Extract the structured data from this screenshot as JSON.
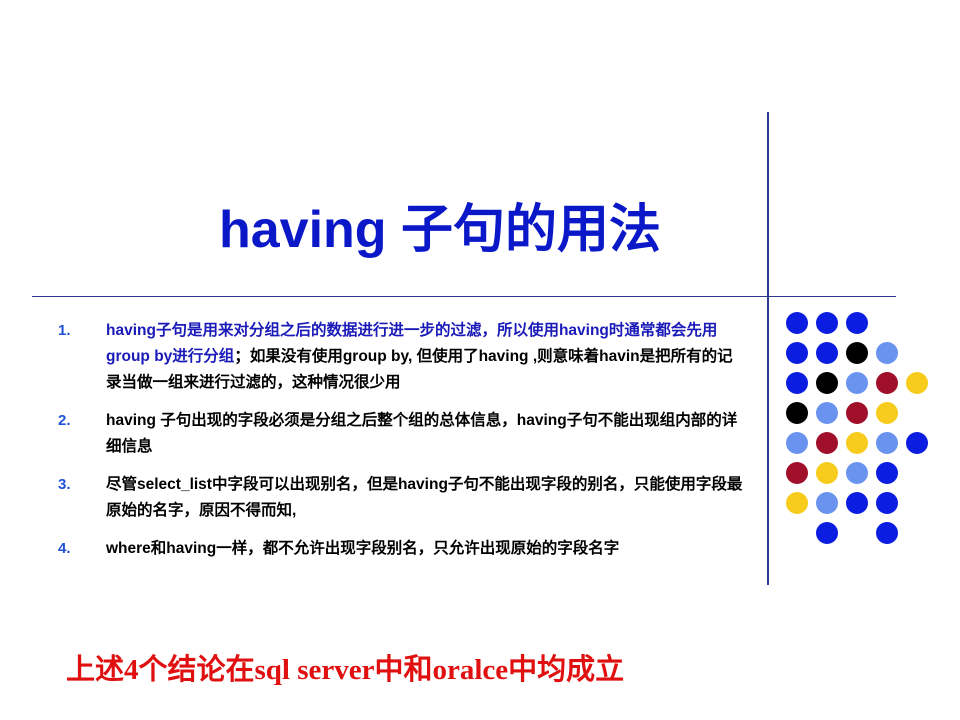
{
  "slide": {
    "title": "having 子句的用法",
    "items": [
      {
        "number": "1.",
        "parts": [
          {
            "text": "having子句是用来对分组之后的数据进行进一步的过滤，所以使用having时通常都会先用group by进行分组",
            "color": "blue"
          },
          {
            "text": "；如果没有使用group by, 但使用了having ,则意味着havin是把所有的记录当做一组来进行过滤的，这种情况很少用",
            "color": "black"
          }
        ]
      },
      {
        "number": "2.",
        "parts": [
          {
            "text": "having 子句出现的字段必须是分组之后整个组的总体信息，having子句不能出现组内部的详细信息",
            "color": "black"
          }
        ]
      },
      {
        "number": "3.",
        "parts": [
          {
            "text": "尽管select_list中字段可以出现别名，但是having子句不能出现字段的别名，只能使用字段最原始的名字，原因不得而知,",
            "color": "black"
          }
        ]
      },
      {
        "number": "4.",
        "parts": [
          {
            "text": "where和having一样，都不允许出现字段别名，只允许出现原始的字段名字",
            "color": "black"
          }
        ]
      }
    ],
    "conclusion": "上述4个结论在sql server中和oralce中均成立"
  },
  "colors": {
    "title": "#0a18c8",
    "number": "#1f52d6",
    "blue_text": "#1a1ab8",
    "conclusion": "#e01010",
    "rule": "#2b3a8f",
    "dot_blue": "#0a1de0",
    "dot_black": "#000000",
    "dot_lightblue": "#6a93f0",
    "dot_red": "#a0102a",
    "dot_yellow": "#f8cc1c"
  },
  "dot_grid": [
    [
      "blue",
      "blue",
      "blue",
      null,
      null
    ],
    [
      "blue",
      "blue",
      "black",
      "lightblue",
      null
    ],
    [
      "blue",
      "black",
      "lightblue",
      "red",
      "yellow"
    ],
    [
      "black",
      "lightblue",
      "red",
      "yellow",
      null
    ],
    [
      "lightblue",
      "red",
      "yellow",
      "lightblue",
      "blue"
    ],
    [
      "red",
      "yellow",
      "lightblue",
      "blue",
      null
    ],
    [
      "yellow",
      "lightblue",
      "blue",
      "blue",
      null
    ],
    [
      null,
      "blue",
      null,
      "blue",
      null
    ]
  ]
}
